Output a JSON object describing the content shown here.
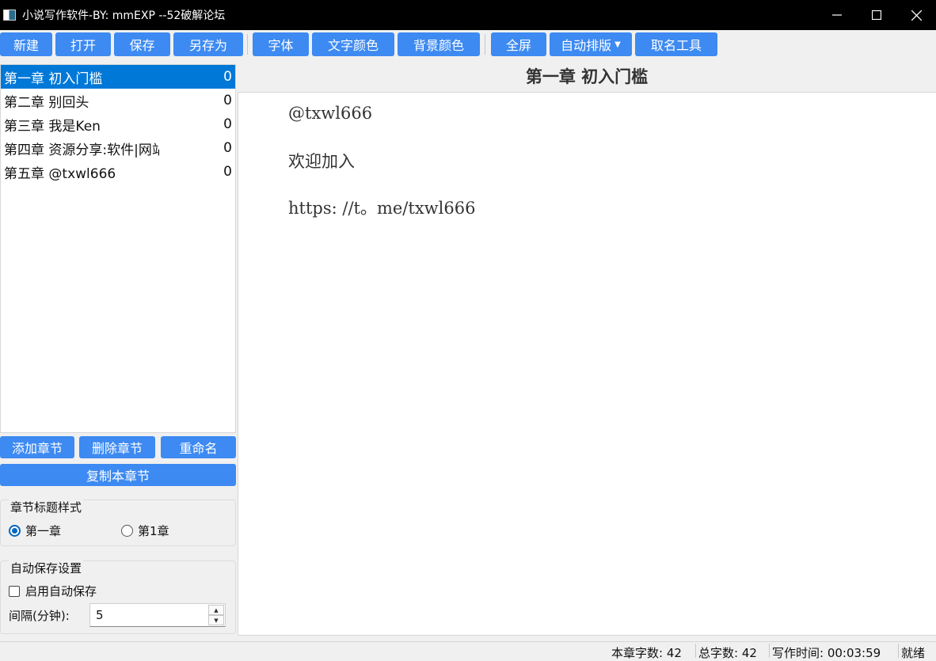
{
  "window": {
    "title": "小说写作软件-BY: mmEXP --52破解论坛",
    "min_glyph": "—",
    "close_glyph": "✕"
  },
  "toolbar": {
    "new_label": "新建",
    "open_label": "打开",
    "save_label": "保存",
    "save_as_label": "另存为",
    "font_label": "字体",
    "text_color_label": "文字颜色",
    "bg_color_label": "背景颜色",
    "fullscreen_label": "全屏",
    "auto_format_label": "自动排版",
    "naming_tool_label": "取名工具",
    "accent_color": "#3d8af2"
  },
  "chapters": [
    {
      "title": "第一章 初入门槛",
      "count": "0",
      "selected": true
    },
    {
      "title": "第二章 别回头",
      "count": "0",
      "selected": false
    },
    {
      "title": "第三章 我是Ken",
      "count": "0",
      "selected": false
    },
    {
      "title": "第四章 资源分享:软件|网站",
      "count": "0",
      "selected": false
    },
    {
      "title": "第五章 @txwl666",
      "count": "0",
      "selected": false
    }
  ],
  "chapter_actions": {
    "add_label": "添加章节",
    "delete_label": "删除章节",
    "rename_label": "重命名",
    "copy_label": "复制本章节"
  },
  "title_style": {
    "group_title": "章节标题样式",
    "option_chinese": "第一章",
    "option_arabic": "第1章",
    "selected": "第一章"
  },
  "autosave": {
    "group_title": "自动保存设置",
    "enable_label": "启用自动保存",
    "enabled": false,
    "interval_label": "间隔(分钟):",
    "interval_value": "5"
  },
  "editor": {
    "chapter_title": "第一章  初入门槛",
    "lines": [
      "@txwl666",
      "欢迎加入",
      "https: //t。me/txwl666"
    ]
  },
  "status": {
    "chapter_words": "本章字数: 42",
    "total_words": "总字数: 42",
    "writing_time": "写作时间: 00:03:59",
    "state": "就绪"
  }
}
